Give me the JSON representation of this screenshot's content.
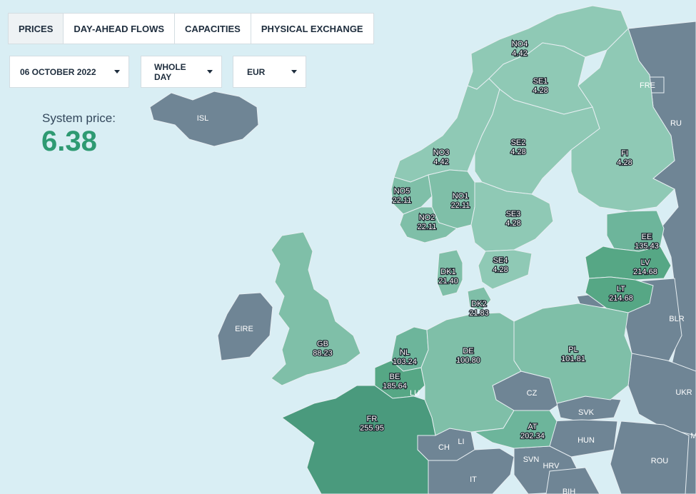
{
  "tabs": [
    {
      "label": "PRICES",
      "active": true
    },
    {
      "label": "DAY-AHEAD FLOWS",
      "active": false
    },
    {
      "label": "CAPACITIES",
      "active": false
    },
    {
      "label": "PHYSICAL EXCHANGE",
      "active": false
    }
  ],
  "filters": {
    "date": "06 OCTOBER 2022",
    "period": "WHOLE DAY",
    "currency": "EUR"
  },
  "system_price": {
    "label": "System price:",
    "value": "6.38"
  },
  "colors": {
    "water": "#d9eef4",
    "non_member": "#6f8595",
    "price_very_low": "#8fc9b5",
    "price_low": "#7fbfa8",
    "price_mid": "#6db59b",
    "price_high": "#56a785",
    "price_very_high": "#4a9a7d",
    "accent": "#2e9a72"
  },
  "zones": [
    {
      "code": "NO4",
      "price": "4.42"
    },
    {
      "code": "SE1",
      "price": "4.28"
    },
    {
      "code": "SE2",
      "price": "4.28"
    },
    {
      "code": "NO3",
      "price": "4.42"
    },
    {
      "code": "FI",
      "price": "4.28"
    },
    {
      "code": "NO5",
      "price": "22.11"
    },
    {
      "code": "NO1",
      "price": "22.11"
    },
    {
      "code": "NO2",
      "price": "22.11"
    },
    {
      "code": "SE3",
      "price": "4.28"
    },
    {
      "code": "EE",
      "price": "135.43"
    },
    {
      "code": "DK1",
      "price": "21.40"
    },
    {
      "code": "SE4",
      "price": "4.28"
    },
    {
      "code": "LV",
      "price": "214.68"
    },
    {
      "code": "LT",
      "price": "214.68"
    },
    {
      "code": "DK2",
      "price": "21.83"
    },
    {
      "code": "GB",
      "price": "88.23"
    },
    {
      "code": "NL",
      "price": "103.24"
    },
    {
      "code": "DE",
      "price": "100.80"
    },
    {
      "code": "PL",
      "price": "101.81"
    },
    {
      "code": "BE",
      "price": "185.64"
    },
    {
      "code": "FR",
      "price": "255.95"
    },
    {
      "code": "AT",
      "price": "202.34"
    }
  ],
  "countries": [
    "ISL",
    "FRE",
    "RU",
    "EIRE",
    "BLR",
    "LU",
    "CZ",
    "UKR",
    "SVK",
    "LI",
    "CH",
    "HUN",
    "SVN",
    "HRV",
    "ROU",
    "IT",
    "BIH",
    "M"
  ]
}
